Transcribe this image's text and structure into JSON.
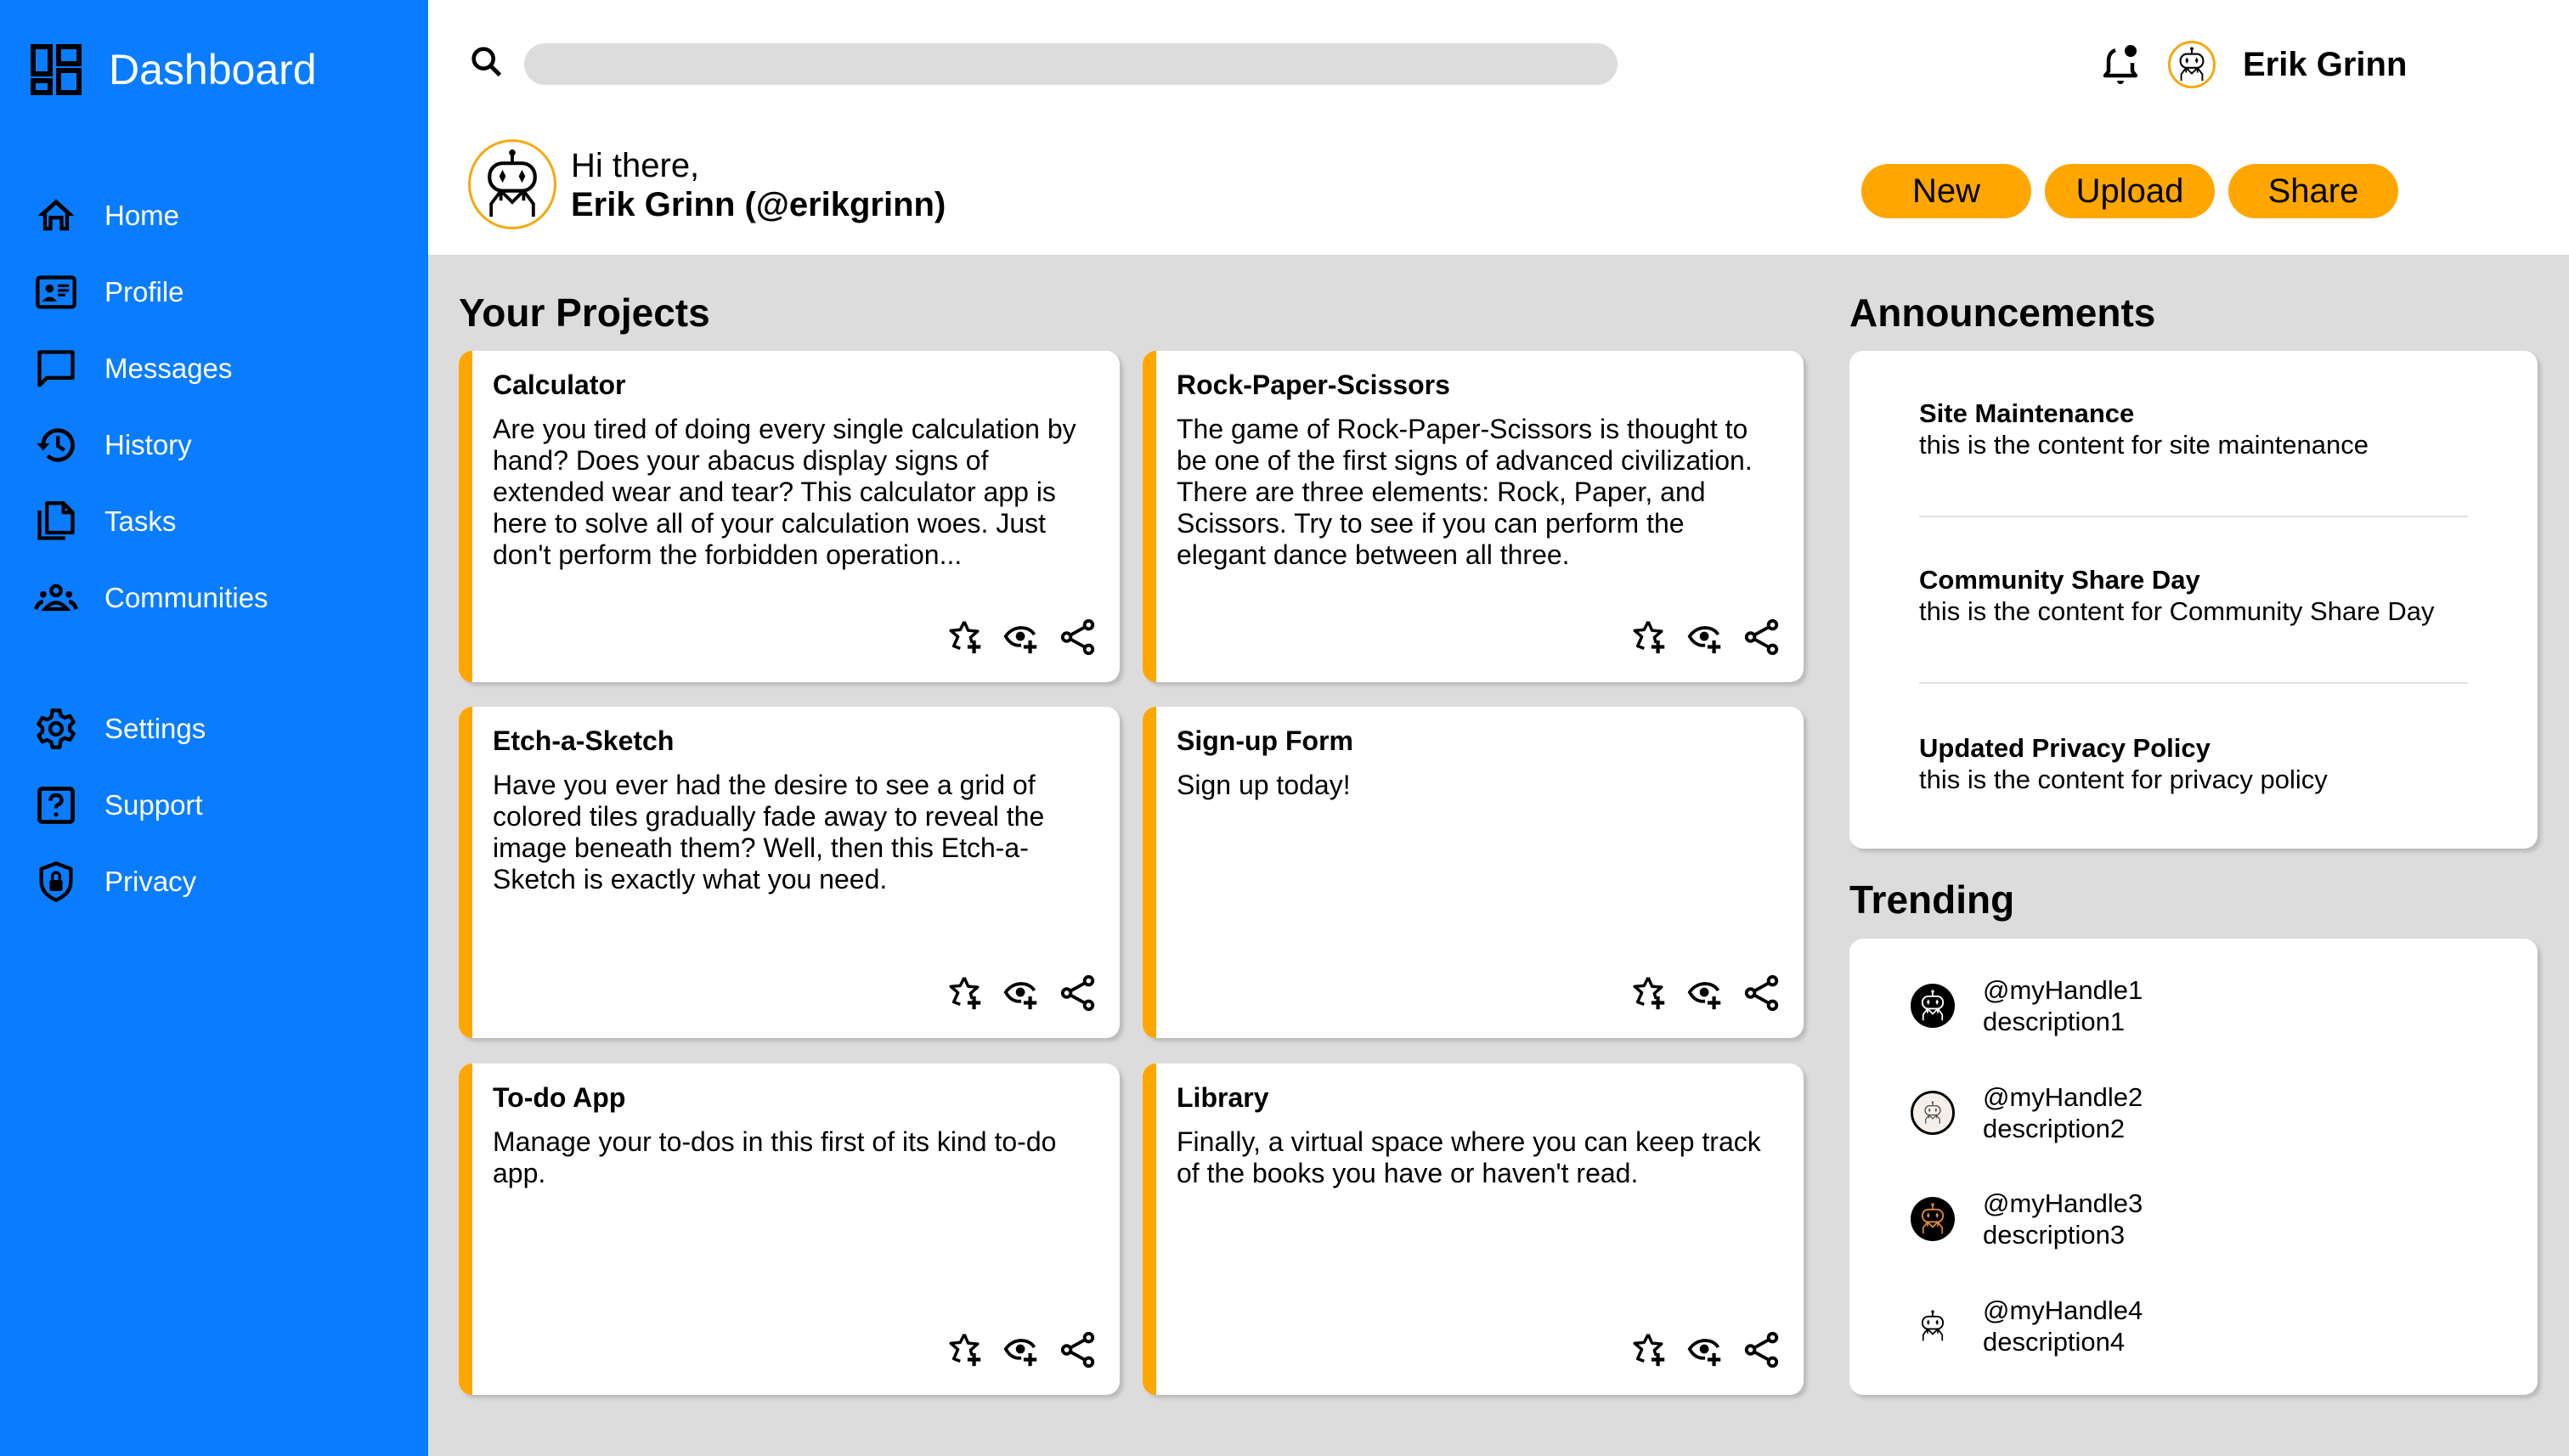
{
  "sidebar": {
    "brand": "Dashboard",
    "items": [
      {
        "label": "Home",
        "icon": "home-icon"
      },
      {
        "label": "Profile",
        "icon": "id-card-icon"
      },
      {
        "label": "Messages",
        "icon": "message-icon"
      },
      {
        "label": "History",
        "icon": "history-icon"
      },
      {
        "label": "Tasks",
        "icon": "documents-icon"
      },
      {
        "label": "Communities",
        "icon": "group-icon"
      },
      {
        "label": "Settings",
        "icon": "gear-icon"
      },
      {
        "label": "Support",
        "icon": "help-icon"
      },
      {
        "label": "Privacy",
        "icon": "shield-lock-icon"
      }
    ]
  },
  "header": {
    "search": {
      "placeholder": "",
      "value": ""
    },
    "username": "Erik Grinn",
    "greeting": "Hi there,",
    "full_name": "Erik Grinn (@erikgrinn)",
    "buttons": {
      "new": "New",
      "upload": "Upload",
      "share": "Share"
    }
  },
  "projects": {
    "title": "Your Projects",
    "items": [
      {
        "title": "Calculator",
        "description": "Are you tired of doing every single calculation by hand? Does your abacus display signs of extended wear and tear? This calculator app is here to solve all of your calculation woes. Just don't perform the forbidden operation..."
      },
      {
        "title": "Rock-Paper-Scissors",
        "description": "The game of Rock-Paper-Scissors is thought to be one of the first signs of advanced civilization. There are three elements: Rock, Paper, and Scissors. Try to see if you can perform the elegant dance between all three."
      },
      {
        "title": "Etch-a-Sketch",
        "description": "Have you ever had the desire to see a grid of colored tiles gradually fade away to reveal the image beneath them? Well, then this Etch-a-Sketch is exactly what you need."
      },
      {
        "title": "Sign-up Form",
        "description": "Sign up today!"
      },
      {
        "title": "To-do App",
        "description": "Manage your to-dos in this first of its kind to-do app."
      },
      {
        "title": "Library",
        "description": "Finally, a virtual space where you can keep track of the books you have or haven't read."
      }
    ]
  },
  "announcements": {
    "title": "Announcements",
    "items": [
      {
        "title": "Site Maintenance",
        "content": "this is the content for site maintenance"
      },
      {
        "title": "Community Share Day",
        "content": "this is the content for Community Share Day"
      },
      {
        "title": "Updated Privacy Policy",
        "content": "this is the content for privacy policy"
      }
    ]
  },
  "trending": {
    "title": "Trending",
    "items": [
      {
        "handle": "@myHandle1",
        "description": "description1"
      },
      {
        "handle": "@myHandle2",
        "description": "description2"
      },
      {
        "handle": "@myHandle3",
        "description": "description3"
      },
      {
        "handle": "@myHandle4",
        "description": "description4"
      }
    ]
  },
  "colors": {
    "sidebar": "#0a7cff",
    "accent": "#ffa600",
    "background": "#dcdcdc"
  }
}
